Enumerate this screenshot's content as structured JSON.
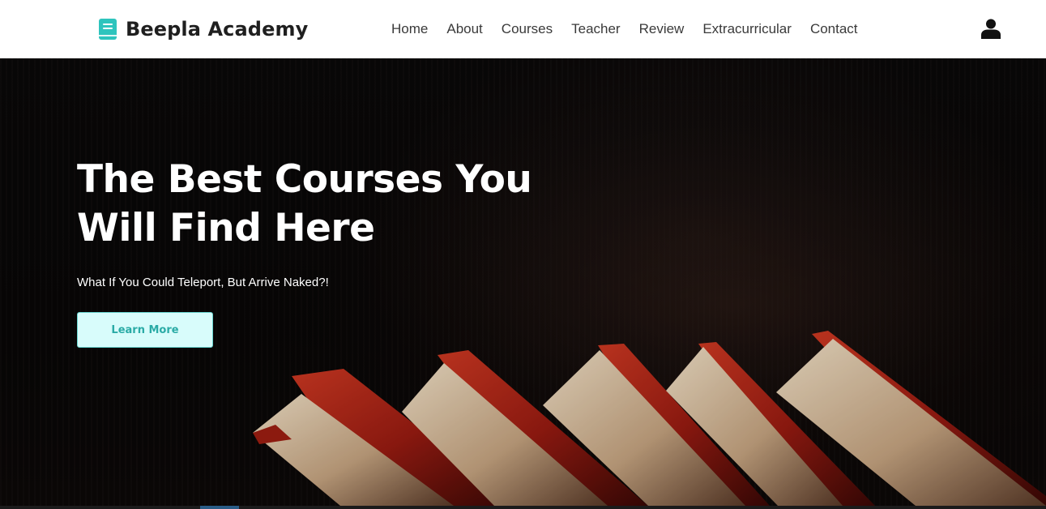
{
  "navbar": {
    "brand_name": "Beepla Academy",
    "brand_icon": "book-icon",
    "menu": [
      {
        "label": "Home"
      },
      {
        "label": "About"
      },
      {
        "label": "Courses"
      },
      {
        "label": "Teacher"
      },
      {
        "label": "Review"
      },
      {
        "label": "Extracurricular"
      },
      {
        "label": "Contact"
      }
    ],
    "user_icon": "user-icon"
  },
  "hero": {
    "title_line1": "The Best Courses You",
    "title_line2": "Will Find Here",
    "subtitle": "What If You Could Teleport, But Arrive Naked?!",
    "button_label": "Learn More",
    "background_image": "red hardcover books fanned on dark background"
  },
  "colors": {
    "brand_accent": "#2ec4bd",
    "button_bg": "#d8fcfb",
    "button_text": "#2aaba6",
    "nav_bg": "#ffffff",
    "hero_bg": "#080606"
  }
}
